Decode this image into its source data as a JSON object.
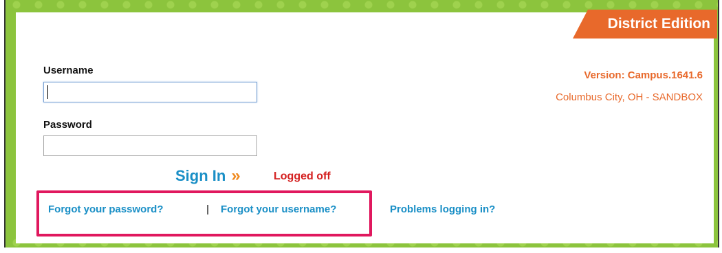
{
  "edition": "District Edition",
  "login": {
    "username_label": "Username",
    "username_value": "",
    "password_label": "Password",
    "password_value": "",
    "signin_label": "Sign In",
    "signin_arrow": "»",
    "status": "Logged off"
  },
  "links": {
    "forgot_password": "Forgot your password?",
    "separator": "|",
    "forgot_username": "Forgot your username?",
    "problems": "Problems logging in?"
  },
  "info": {
    "version": "Version: Campus.1641.6",
    "district": "Columbus City, OH - SANDBOX"
  },
  "colors": {
    "brand_orange": "#e8692b",
    "link_blue": "#1a8fc6",
    "status_red": "#d42020",
    "frame_green": "#8cc43d",
    "highlight_pink": "#e0185e"
  }
}
